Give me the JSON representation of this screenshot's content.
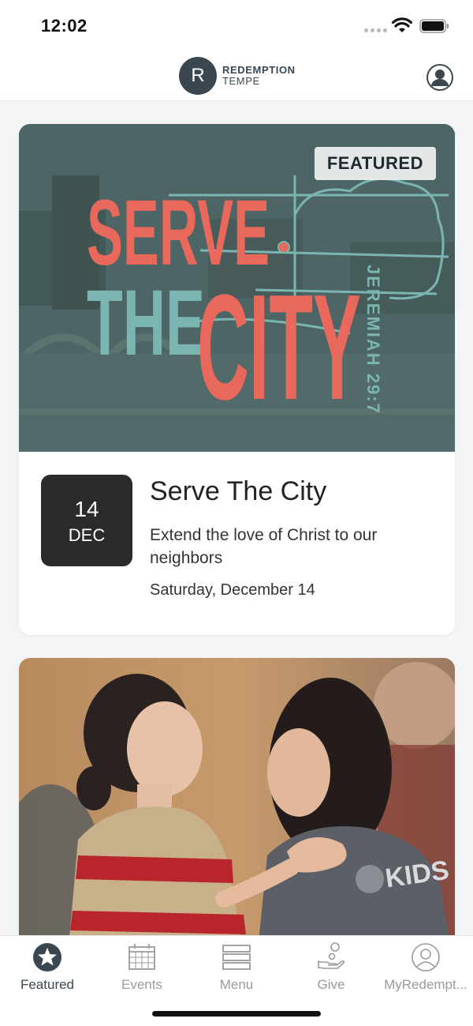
{
  "status": {
    "time": "12:02"
  },
  "header": {
    "logo_mark": "R",
    "logo_line1": "REDEMPTION",
    "logo_line2": "TEMPE"
  },
  "featured_card": {
    "badge": "FEATURED",
    "graphic_text": {
      "line1": "SERVE",
      "line2": "THE",
      "line3": "CITY",
      "reference": "JEREMIAH 29:7"
    },
    "date_day": "14",
    "date_month": "DEC",
    "title": "Serve The City",
    "description": "Extend the love of Christ to our neighbors",
    "date_text": "Saturday, December 14"
  },
  "second_card": {
    "shirt_text": "KIDS"
  },
  "tabs": [
    {
      "label": "Featured",
      "icon": "star-icon",
      "active": true
    },
    {
      "label": "Events",
      "icon": "calendar-icon",
      "active": false
    },
    {
      "label": "Menu",
      "icon": "menu-icon",
      "active": false
    },
    {
      "label": "Give",
      "icon": "give-icon",
      "active": false
    },
    {
      "label": "MyRedempt...",
      "icon": "user-icon",
      "active": false
    }
  ],
  "colors": {
    "brand": "#3a4750",
    "hero_bg": "#4a6261",
    "accent_red": "#e8685b",
    "accent_teal": "#7bb5b2"
  }
}
